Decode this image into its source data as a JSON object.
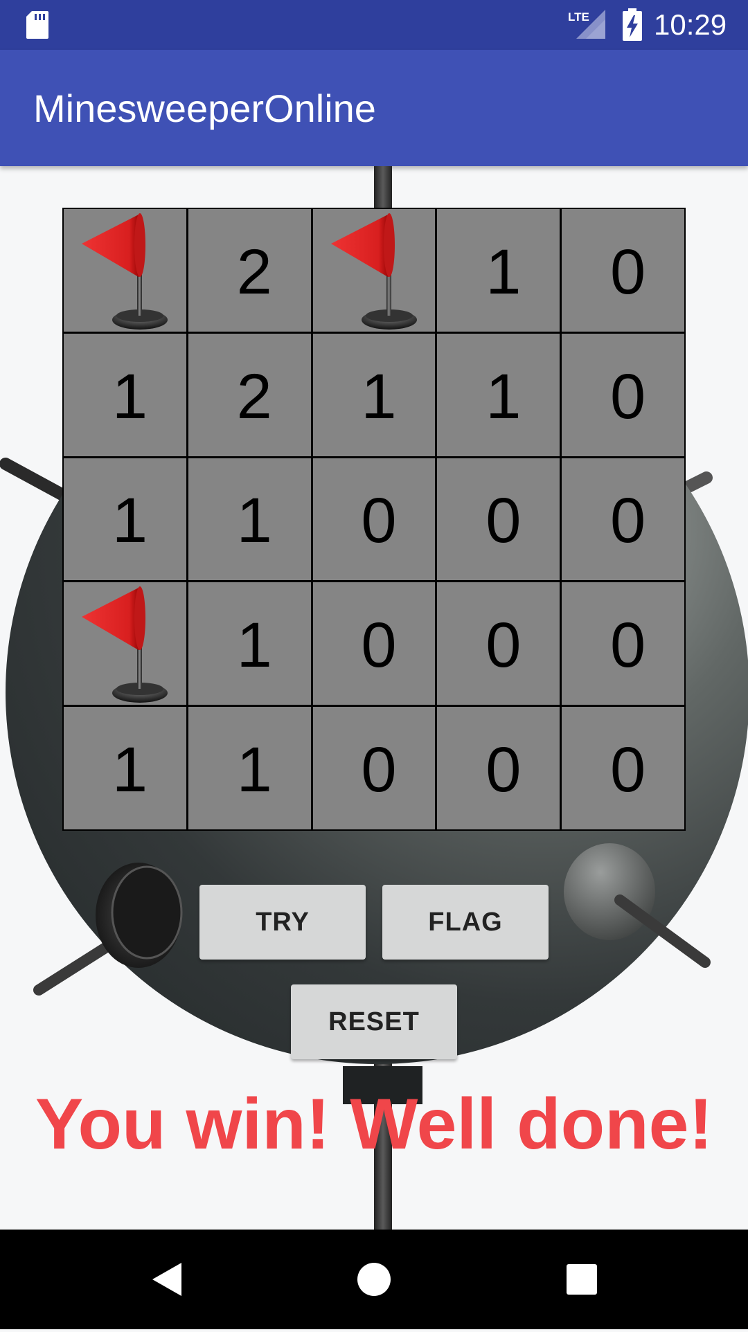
{
  "status_bar": {
    "time": "10:29",
    "network": "LTE",
    "icons": [
      "sd-card-icon",
      "lte-signal-icon",
      "battery-charging-icon"
    ]
  },
  "app_bar": {
    "title": "MinesweeperOnline"
  },
  "board": {
    "rows": [
      [
        "flag",
        "2",
        "flag",
        "1",
        "0"
      ],
      [
        "1",
        "2",
        "1",
        "1",
        "0"
      ],
      [
        "1",
        "1",
        "0",
        "0",
        "0"
      ],
      [
        "flag",
        "1",
        "0",
        "0",
        "0"
      ],
      [
        "1",
        "1",
        "0",
        "0",
        "0"
      ]
    ],
    "cell_color": "#858585",
    "flag_color": "#d81f1f"
  },
  "buttons": {
    "try_label": "TRY",
    "flag_label": "FLAG",
    "reset_label": "RESET"
  },
  "message": {
    "text": "You win! Well done!",
    "color": "#f0464a"
  },
  "nav_bar": {
    "icons": [
      "back-icon",
      "home-icon",
      "recents-icon"
    ]
  },
  "colors": {
    "status_bar": "#2f3f9d",
    "app_bar": "#3f51b5",
    "background": "#f6f7f8"
  }
}
